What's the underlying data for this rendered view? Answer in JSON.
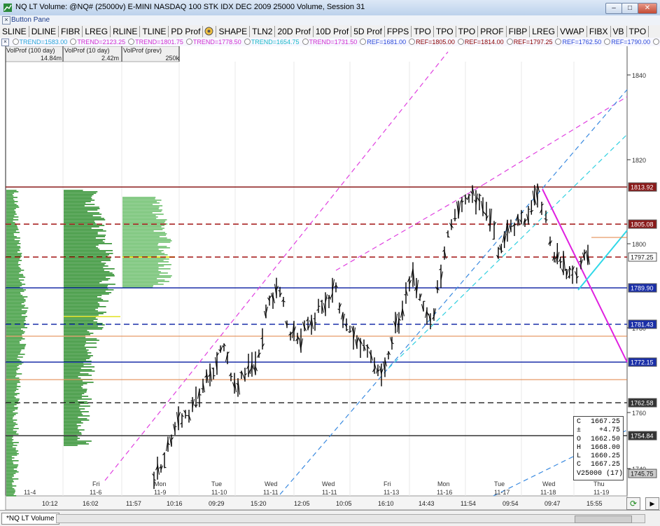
{
  "window": {
    "title": "NQ LT Volume: @NQ# (25000v) E-MINI NASDAQ 100 STK IDX DEC 2009 25000 Volume, Session 31",
    "buttons": [
      "–",
      "□",
      "✕"
    ]
  },
  "button_pane": {
    "label": "Button Pane"
  },
  "toolbar": [
    "SLINE",
    "DLINE",
    "FIBR",
    "LREG",
    "RLINE",
    "TLINE",
    "PD Prof",
    "SHAPE",
    "TLN2",
    "20D Prof",
    "10D Prof",
    "5D Prof",
    "FPPS",
    "TPO",
    "TPO",
    "TPO",
    "PROF",
    "FIBP",
    "LREG",
    "VWAP",
    "FIBX",
    "VB",
    "TPO"
  ],
  "studies": [
    {
      "label": "TREND=1583.00",
      "color": "#2aa6d8"
    },
    {
      "label": "TREND=2123.25",
      "color": "#d02ed0"
    },
    {
      "label": "TREND=1801.75",
      "color": "#d02ed0"
    },
    {
      "label": "TREND=1778.50",
      "color": "#d02ed0"
    },
    {
      "label": "TREND=1654.75",
      "color": "#19b9c8"
    },
    {
      "label": "TREND=1731.50",
      "color": "#d02ed0"
    },
    {
      "label": "REF=1681.00",
      "color": "#2a48d8"
    },
    {
      "label": "REF=1805.00",
      "color": "#8a0000"
    },
    {
      "label": "REF=1814.00",
      "color": "#8a0000"
    },
    {
      "label": "REF=1797.25",
      "color": "#8a0000"
    },
    {
      "label": "REF=1762.50",
      "color": "#2a48d8"
    },
    {
      "label": "REF=1790.00",
      "color": "#2a48d8"
    },
    {
      "label": "REF=178",
      "color": "#8a0000"
    }
  ],
  "vol_panes": [
    {
      "label": "VolProf (100 day)",
      "value": "14.84m"
    },
    {
      "label": "VolProf (10 day)",
      "value": "2.42m"
    },
    {
      "label": "VolProf (prev)",
      "value": "250k"
    }
  ],
  "price_axis": {
    "ticks": [
      "1840",
      "1820",
      "1800",
      "1780",
      "1760",
      "1740"
    ],
    "levels": [
      {
        "value": "1813.92",
        "bg": "#8a1a1a"
      },
      {
        "value": "1805.08",
        "bg": "#8a1a1a"
      },
      {
        "value": "1797.25",
        "bg": "#ffffff"
      },
      {
        "value": "1789.90",
        "bg": "#1a2fa8"
      },
      {
        "value": "1781.43",
        "bg": "#1a2fa8"
      },
      {
        "value": "1772.15",
        "bg": "#1a2fa8"
      },
      {
        "value": "1762.58",
        "bg": "#333333"
      },
      {
        "value": "1754.84",
        "bg": "#333333"
      },
      {
        "value": "1745.75",
        "bg": "#cccccc"
      }
    ]
  },
  "time_axis": {
    "days": [
      "Fri",
      "Mon",
      "Tue",
      "Wed",
      "Wed",
      "Fri",
      "Mon",
      "Tue",
      "Wed",
      "Thu"
    ],
    "dates": [
      "11-4",
      "11-6",
      "11-9",
      "11-10",
      "11-11",
      "11-11",
      "11-13",
      "11-16",
      "11-17",
      "11-18",
      "11-19"
    ],
    "times": [
      "10:12",
      "16:02",
      "11:57",
      "10:16",
      "09:29",
      "15:20",
      "12:05",
      "10:05",
      "16:10",
      "14:43",
      "11:54",
      "09:54",
      "09:47",
      "15:55"
    ]
  },
  "infobox": [
    {
      "k": "C",
      "v": "1667.25"
    },
    {
      "k": "±",
      "v": "+4.75"
    },
    {
      "k": "O",
      "v": "1662.50"
    },
    {
      "k": "H",
      "v": "1668.00"
    },
    {
      "k": "L",
      "v": "1660.25"
    },
    {
      "k": "C",
      "v": "1667.25"
    },
    {
      "k": "V",
      "v": "25000 (17)"
    }
  ],
  "bottom_tab": "*NQ LT Volume"
}
